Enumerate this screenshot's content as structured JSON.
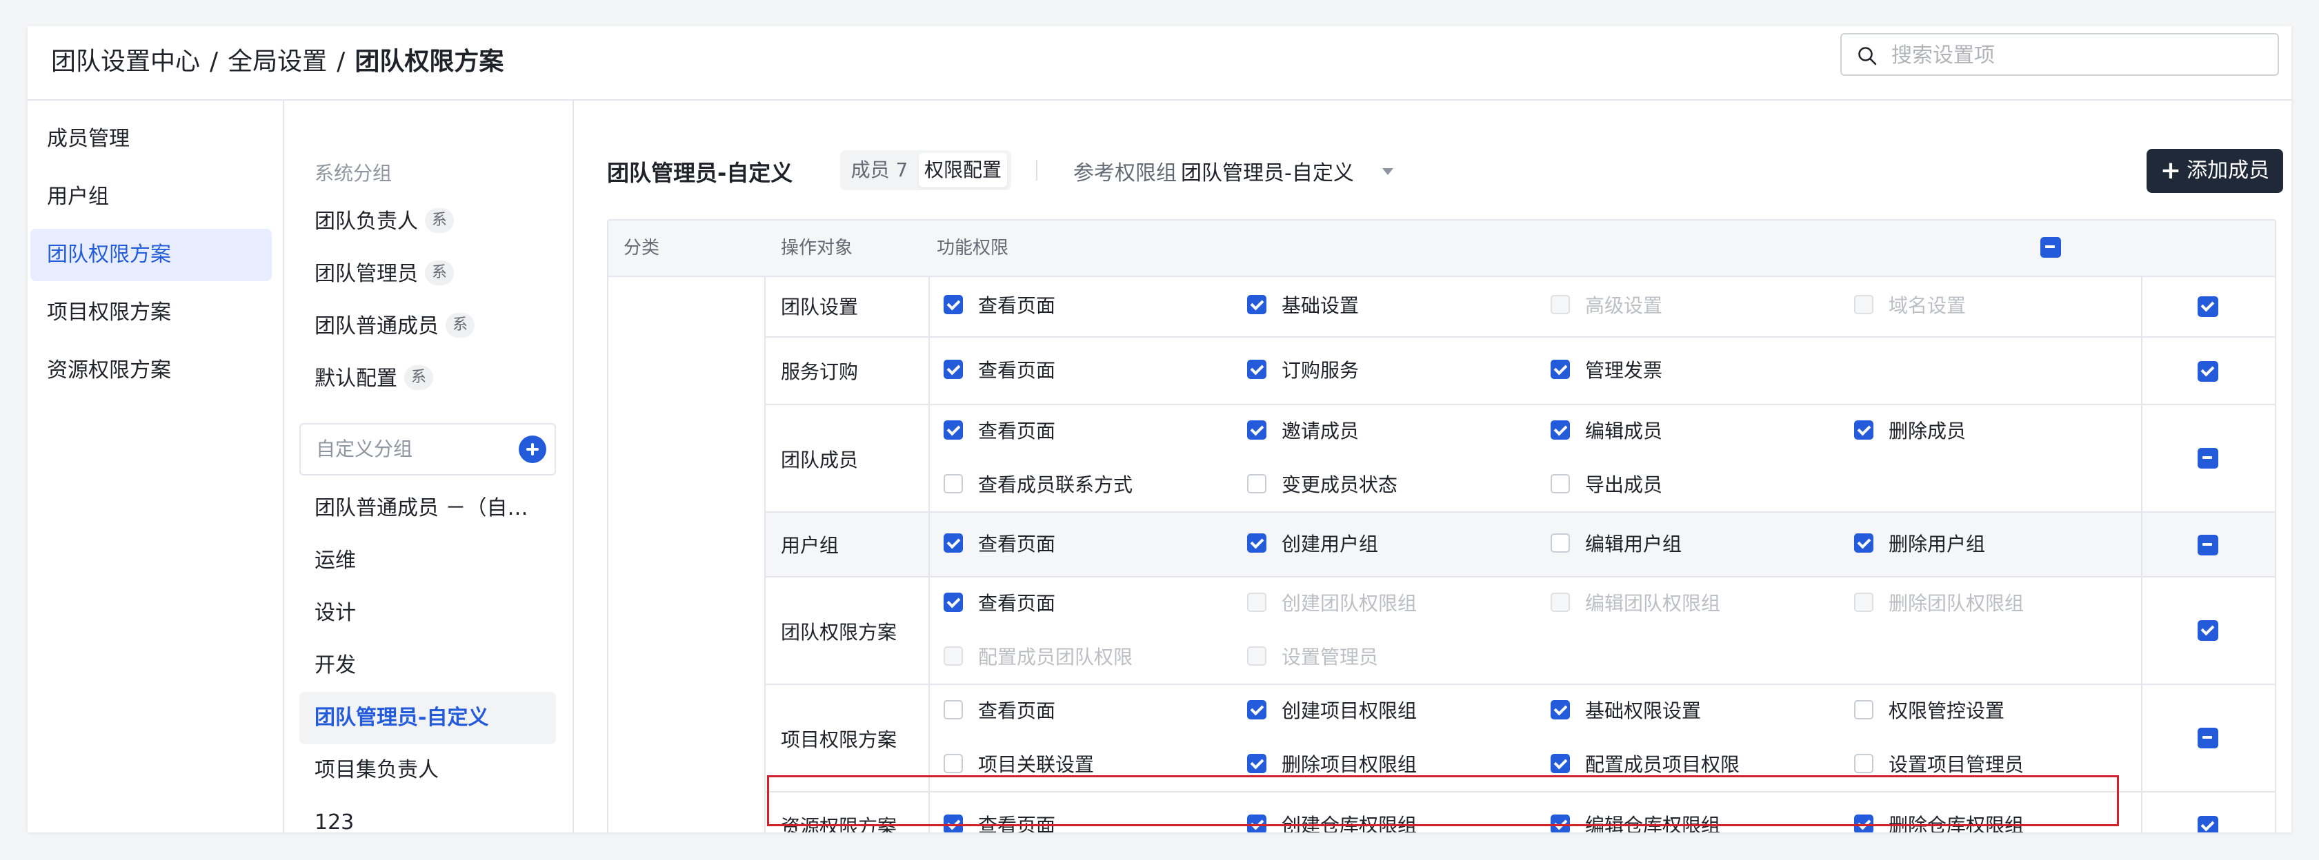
{
  "breadcrumb": {
    "level1": "团队设置中心",
    "level2": "全局设置",
    "current": "团队权限方案",
    "separator": "/"
  },
  "search": {
    "placeholder": "搜索设置项",
    "icon": "search-icon"
  },
  "nav_primary": {
    "items": [
      {
        "label": "成员管理",
        "active": false
      },
      {
        "label": "用户组",
        "active": false
      },
      {
        "label": "团队权限方案",
        "active": true
      },
      {
        "label": "项目权限方案",
        "active": false
      },
      {
        "label": "资源权限方案",
        "active": false
      }
    ]
  },
  "nav_secondary": {
    "system_group_title": "系统分组",
    "system_badge": "系",
    "system_items": [
      {
        "label": "团队负责人"
      },
      {
        "label": "团队管理员"
      },
      {
        "label": "团队普通成员"
      },
      {
        "label": "默认配置"
      }
    ],
    "custom_group_title": "自定义分组",
    "custom_items": [
      {
        "label": "团队普通成员 －（自…",
        "active": false
      },
      {
        "label": "运维",
        "active": false
      },
      {
        "label": "设计",
        "active": false
      },
      {
        "label": "开发",
        "active": false
      },
      {
        "label": "团队管理员-自定义",
        "active": true
      },
      {
        "label": "项目集负责人",
        "active": false
      },
      {
        "label": "123",
        "active": false
      }
    ]
  },
  "toolbar": {
    "title": "团队管理员-自定义",
    "tab_members_label": "成员",
    "tab_members_count": "7",
    "tab_permissions_label": "权限配置",
    "reference_label": "参考权限组",
    "reference_value": "团队管理员-自定义",
    "add_member_label": "添加成员"
  },
  "table": {
    "headers": {
      "category": "分类",
      "object": "操作对象",
      "permissions": "功能权限"
    },
    "header_state": "indeterminate",
    "rows": [
      {
        "object": "团队设置",
        "row_state": "checked",
        "shaded": false,
        "perms": [
          {
            "label": "查看页面",
            "state": "checked"
          },
          {
            "label": "基础设置",
            "state": "checked"
          },
          {
            "label": "高级设置",
            "state": "disabled"
          },
          {
            "label": "域名设置",
            "state": "disabled"
          }
        ]
      },
      {
        "object": "服务订购",
        "row_state": "checked",
        "shaded": false,
        "perms": [
          {
            "label": "查看页面",
            "state": "checked"
          },
          {
            "label": "订购服务",
            "state": "checked"
          },
          {
            "label": "管理发票",
            "state": "checked"
          }
        ]
      },
      {
        "object": "团队成员",
        "row_state": "indeterminate",
        "shaded": false,
        "perms": [
          {
            "label": "查看页面",
            "state": "checked"
          },
          {
            "label": "邀请成员",
            "state": "checked"
          },
          {
            "label": "编辑成员",
            "state": "checked"
          },
          {
            "label": "删除成员",
            "state": "checked"
          },
          {
            "label": "查看成员联系方式",
            "state": "unchecked"
          },
          {
            "label": "变更成员状态",
            "state": "unchecked"
          },
          {
            "label": "导出成员",
            "state": "unchecked"
          }
        ]
      },
      {
        "object": "用户组",
        "row_state": "indeterminate",
        "shaded": true,
        "perms": [
          {
            "label": "查看页面",
            "state": "checked"
          },
          {
            "label": "创建用户组",
            "state": "checked"
          },
          {
            "label": "编辑用户组",
            "state": "unchecked"
          },
          {
            "label": "删除用户组",
            "state": "checked"
          }
        ]
      },
      {
        "object": "团队权限方案",
        "row_state": "checked",
        "shaded": false,
        "perms": [
          {
            "label": "查看页面",
            "state": "checked"
          },
          {
            "label": "创建团队权限组",
            "state": "disabled"
          },
          {
            "label": "编辑团队权限组",
            "state": "disabled"
          },
          {
            "label": "删除团队权限组",
            "state": "disabled"
          },
          {
            "label": "配置成员团队权限",
            "state": "disabled"
          },
          {
            "label": "设置管理员",
            "state": "disabled"
          }
        ]
      },
      {
        "object": "项目权限方案",
        "row_state": "indeterminate",
        "shaded": false,
        "perms": [
          {
            "label": "查看页面",
            "state": "unchecked"
          },
          {
            "label": "创建项目权限组",
            "state": "checked"
          },
          {
            "label": "基础权限设置",
            "state": "checked"
          },
          {
            "label": "权限管控设置",
            "state": "unchecked"
          },
          {
            "label": "项目关联设置",
            "state": "unchecked"
          },
          {
            "label": "删除项目权限组",
            "state": "checked"
          },
          {
            "label": "配置成员项目权限",
            "state": "checked"
          },
          {
            "label": "设置项目管理员",
            "state": "unchecked"
          }
        ]
      },
      {
        "object": "资源权限方案",
        "row_state": "checked",
        "shaded": false,
        "perms": [
          {
            "label": "查看页面",
            "state": "checked"
          },
          {
            "label": "创建仓库权限组",
            "state": "checked"
          },
          {
            "label": "编辑仓库权限组",
            "state": "checked"
          },
          {
            "label": "删除仓库权限组",
            "state": "checked"
          }
        ]
      }
    ]
  },
  "colors": {
    "accent": "#245bdb",
    "selected_bg": "#e8eeff",
    "highlight_border": "#d0222c",
    "primary_button": "#1f2937"
  }
}
